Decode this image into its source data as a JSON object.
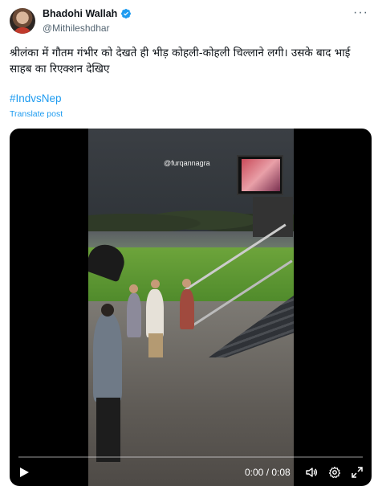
{
  "author": {
    "display_name": "Bhadohi Wallah",
    "handle": "@Mithileshdhar",
    "verified_color": "#1d9bf0"
  },
  "post": {
    "text": "श्रीलंका में गौतम गंभीर को देखते ही भीड़ कोहली-कोहली चिल्लाने लगी। उसके बाद भाई साहब का रिएक्शन देखिए",
    "hashtag": "#IndvsNep",
    "translate_label": "Translate post",
    "more_icon": "more-dots-icon"
  },
  "video": {
    "watermark": "@furqannagra",
    "time_display": "0:00 / 0:08",
    "progress": 0.0,
    "accent_color": "#1d9bf0"
  }
}
